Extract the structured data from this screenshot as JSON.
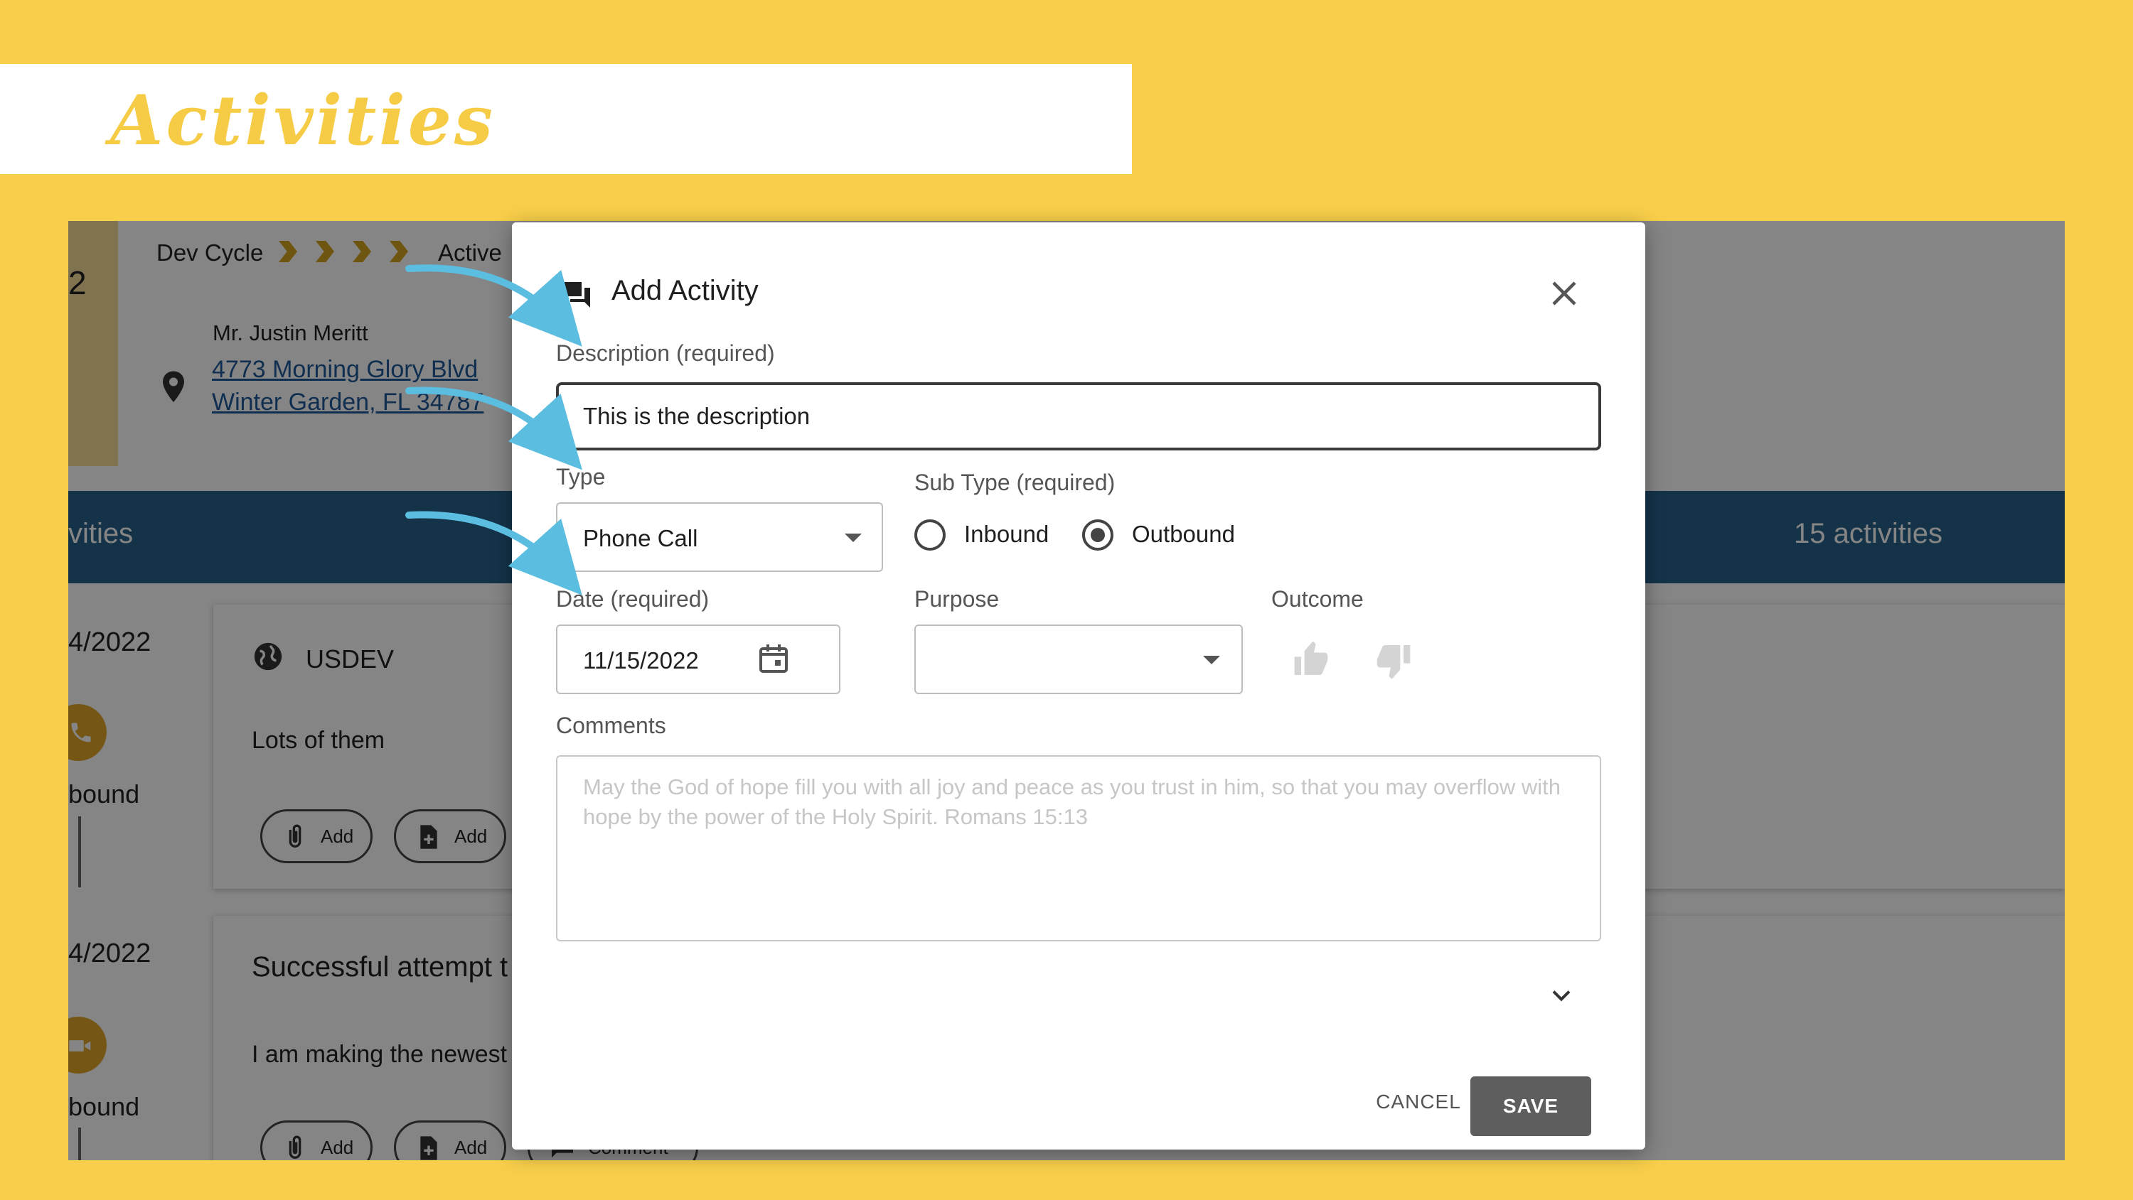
{
  "slide": {
    "title": "Activities",
    "colors": {
      "background": "#f8cf4a",
      "banner": "#ffffff",
      "title": "#f6cb45",
      "arrow": "#5bbde0"
    }
  },
  "background_app": {
    "left_accent_char": "2",
    "dev_cycle_label": "Dev Cycle",
    "status": "Active",
    "contact_name": "Mr. Justin Meritt",
    "address_line1": "4773 Morning Glory Blvd",
    "address_line2": "Winter Garden, FL 34787",
    "activities_bar_label": "vities",
    "activities_count": "15 activities",
    "timeline": [
      {
        "date": "4/2022",
        "direction": "bound",
        "icon": "phone-icon"
      },
      {
        "date": "4/2022",
        "direction": "bound",
        "icon": "video-icon"
      }
    ],
    "cards": [
      {
        "title": "USDEV",
        "body": "Lots of them",
        "buttons": [
          "Add",
          "Add"
        ]
      },
      {
        "title": "Successful attempt t",
        "body": "I am making the newest",
        "buttons": [
          "Add",
          "Add",
          "Comment"
        ]
      }
    ],
    "colors": {
      "bar": "#27628c",
      "accent": "#d4a520",
      "link": "#1f5b99"
    }
  },
  "dialog": {
    "title": "Add Activity",
    "description_label": "Description (required)",
    "description_value": "This is the description",
    "type_label": "Type",
    "type_value": "Phone Call",
    "subtype_label": "Sub Type (required)",
    "subtype_options": [
      {
        "label": "Inbound",
        "selected": false
      },
      {
        "label": "Outbound",
        "selected": true
      }
    ],
    "date_label": "Date (required)",
    "date_value": "11/15/2022",
    "purpose_label": "Purpose",
    "purpose_value": "",
    "outcome_label": "Outcome",
    "comments_label": "Comments",
    "comments_placeholder": "May the God of hope fill you with all joy and peace as you trust in him, so that you may overflow with hope by the power of the Holy Spirit. Romans 15:13",
    "cancel_label": "CANCEL",
    "save_label": "SAVE"
  }
}
